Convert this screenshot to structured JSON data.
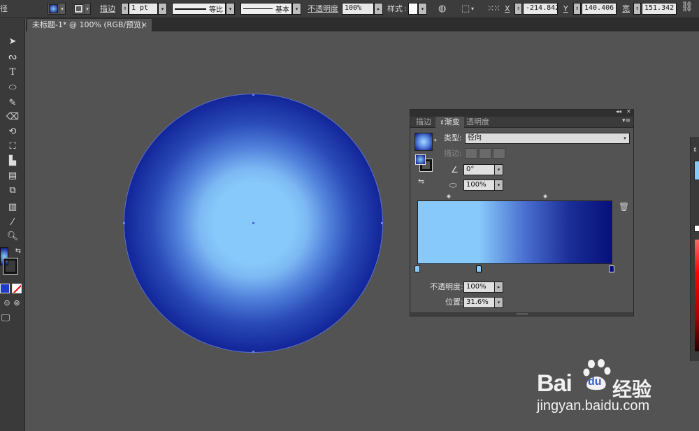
{
  "control_bar": {
    "cut_label": "径",
    "stroke_label": "描边",
    "stroke_weight": "1 pt",
    "stroke_profile": "等比",
    "brush": "基本",
    "opacity_label": "不透明度",
    "opacity_value": "100%",
    "style_label": "样式",
    "x_label": "X",
    "x_value": "-214.842",
    "y_label": "Y",
    "y_value": "140.406",
    "w_label": "宽",
    "w_value": "151.342",
    "accent": "#e8912d"
  },
  "document": {
    "tab_title": "未标题-1* @ 100% (RGB/预览)",
    "close_glyph": "×"
  },
  "toolbar": {
    "tools": [
      "selection-tool",
      "direct-selection-tool",
      "lasso-tool",
      "type-tool",
      "ellipse-tool",
      "pencil-tool",
      "eraser-tool",
      "rotate-tool",
      "free-transform-tool",
      "graph-tool",
      "gradient-tool",
      "blend-tool",
      "column-graph-tool",
      "eyedropper-tool",
      "zoom-tool",
      "fill-stroke",
      "swap-icon",
      "color-mode",
      "none-icon",
      "draw-mode",
      "screen-mode"
    ]
  },
  "gradient_panel": {
    "tabs": [
      "描边",
      "渐变",
      "透明度"
    ],
    "active_tab": "渐变",
    "type_label": "类型:",
    "type_value": "径向",
    "stroke_label": "描边:",
    "angle_value": "0°",
    "aspect_value": "100%",
    "opacity_label": "不透明度:",
    "opacity_value": "100%",
    "location_label": "位置:",
    "location_value": "31.6%",
    "colors": {
      "light": "#87c9fa",
      "dark": "#07107a"
    }
  },
  "canvas": {
    "shape": "circle",
    "fill": "radial gradient"
  },
  "watermark": {
    "brand_latin": "Bai",
    "brand_latin2": "du",
    "brand_cn": "经验",
    "url": "jingyan.baidu.com"
  }
}
